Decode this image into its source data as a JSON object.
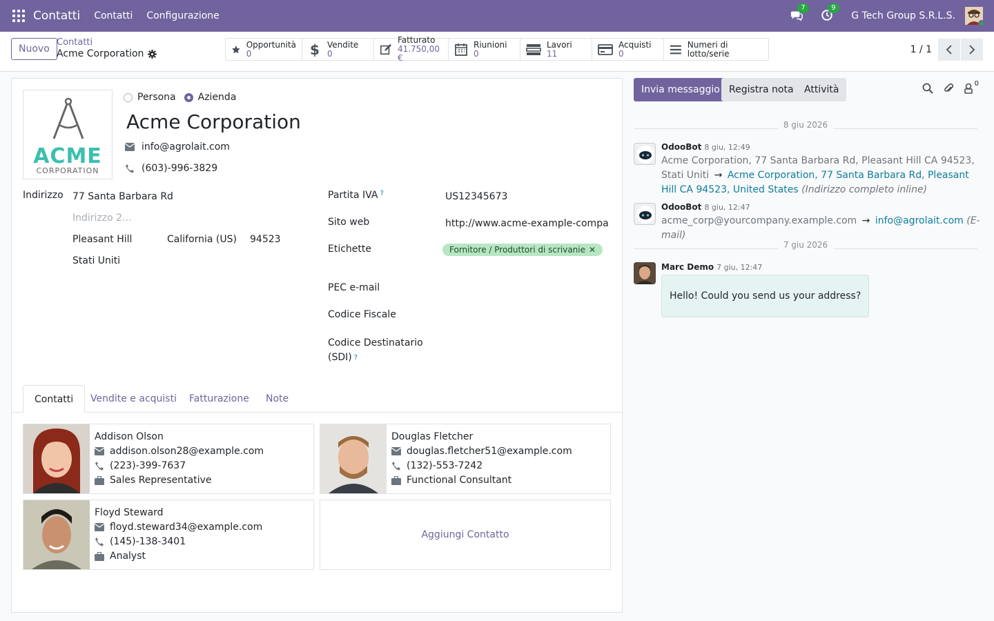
{
  "topbar": {
    "app_name": "Contatti",
    "menu": [
      "Contatti",
      "Configurazione"
    ],
    "messages_count": "7",
    "activities_count": "9",
    "company": "G Tech Group S.R.L.S."
  },
  "control": {
    "new_label": "Nuovo",
    "breadcrumb_parent": "Contatti",
    "breadcrumb_current": "Acme Corporation",
    "pager": "1 / 1",
    "smart_buttons": [
      {
        "label": "Opportunità",
        "value": "0",
        "icon": "star-icon"
      },
      {
        "label": "Vendite",
        "value": "0",
        "icon": "dollar-icon"
      },
      {
        "label": "Fatturato",
        "value": "41.750,00 €",
        "icon": "edit-icon"
      },
      {
        "label": "Riunioni",
        "value": "0",
        "icon": "calendar-icon"
      },
      {
        "label": "Lavori",
        "value": "11",
        "icon": "tasks-icon"
      },
      {
        "label": "Acquisti",
        "value": "0",
        "icon": "credit-card-icon"
      },
      {
        "label": "Numeri di lotto/serie",
        "value": "",
        "icon": "bars-icon"
      }
    ]
  },
  "form": {
    "logo_text": "ACME",
    "logo_subtext": "CORPORATION",
    "type_person": "Persona",
    "type_company": "Azienda",
    "name": "Acme Corporation",
    "email": "info@agrolait.com",
    "phone": "(603)-996-3829",
    "address_label": "Indirizzo",
    "street": "77 Santa Barbara Rd",
    "street2_placeholder": "Indirizzo 2...",
    "city": "Pleasant Hill",
    "state": "California (US)",
    "zip": "94523",
    "country": "Stati Uniti",
    "vat_label": "Partita IVA",
    "vat": "US12345673",
    "website_label": "Sito web",
    "website": "http://www.acme-example-company.com",
    "tags_label": "Etichette",
    "tag": "Fornitore / Produttori di scrivanie",
    "pec_label": "PEC e-mail",
    "fiscal_label": "Codice Fiscale",
    "sdi_label_1": "Codice Destinatario",
    "sdi_label_2": "(SDI)",
    "help_mark": "?",
    "tabs": [
      "Contatti",
      "Vendite e acquisti",
      "Fatturazione",
      "Note"
    ],
    "contacts": [
      {
        "name": "Addison Olson",
        "email": "addison.olson28@example.com",
        "phone": "(223)-399-7637",
        "job": "Sales Representative"
      },
      {
        "name": "Douglas Fletcher",
        "email": "douglas.fletcher51@example.com",
        "phone": "(132)-553-7242",
        "job": "Functional Consultant"
      },
      {
        "name": "Floyd Steward",
        "email": "floyd.steward34@example.com",
        "phone": "(145)-138-3401",
        "job": "Analyst"
      }
    ],
    "add_contact": "Aggiungi Contatto"
  },
  "chatter": {
    "send_message": "Invia messaggio",
    "log_note": "Registra nota",
    "activities": "Attività",
    "followers_count": "0",
    "date1": "8 giu 2026",
    "date2": "7 giu 2026",
    "arrow": "→",
    "messages": [
      {
        "author": "OdooBot",
        "time": "8 giu, 12:49",
        "old": "Acme Corporation, 77 Santa Barbara Rd, Pleasant Hill CA 94523, Stati Uniti",
        "new": "Acme Corporation, 77 Santa Barbara Rd, Pleasant Hill CA 94523, United States",
        "field": "(Indirizzo completo inline)"
      },
      {
        "author": "OdooBot",
        "time": "8 giu, 12:47",
        "old": "acme_corp@yourcompany.example.com",
        "new": "info@agrolait.com",
        "field": "(E-mail)"
      },
      {
        "author": "Marc Demo",
        "time": "7 giu, 12:47",
        "text": "Hello! Could you send us your address?"
      }
    ]
  }
}
